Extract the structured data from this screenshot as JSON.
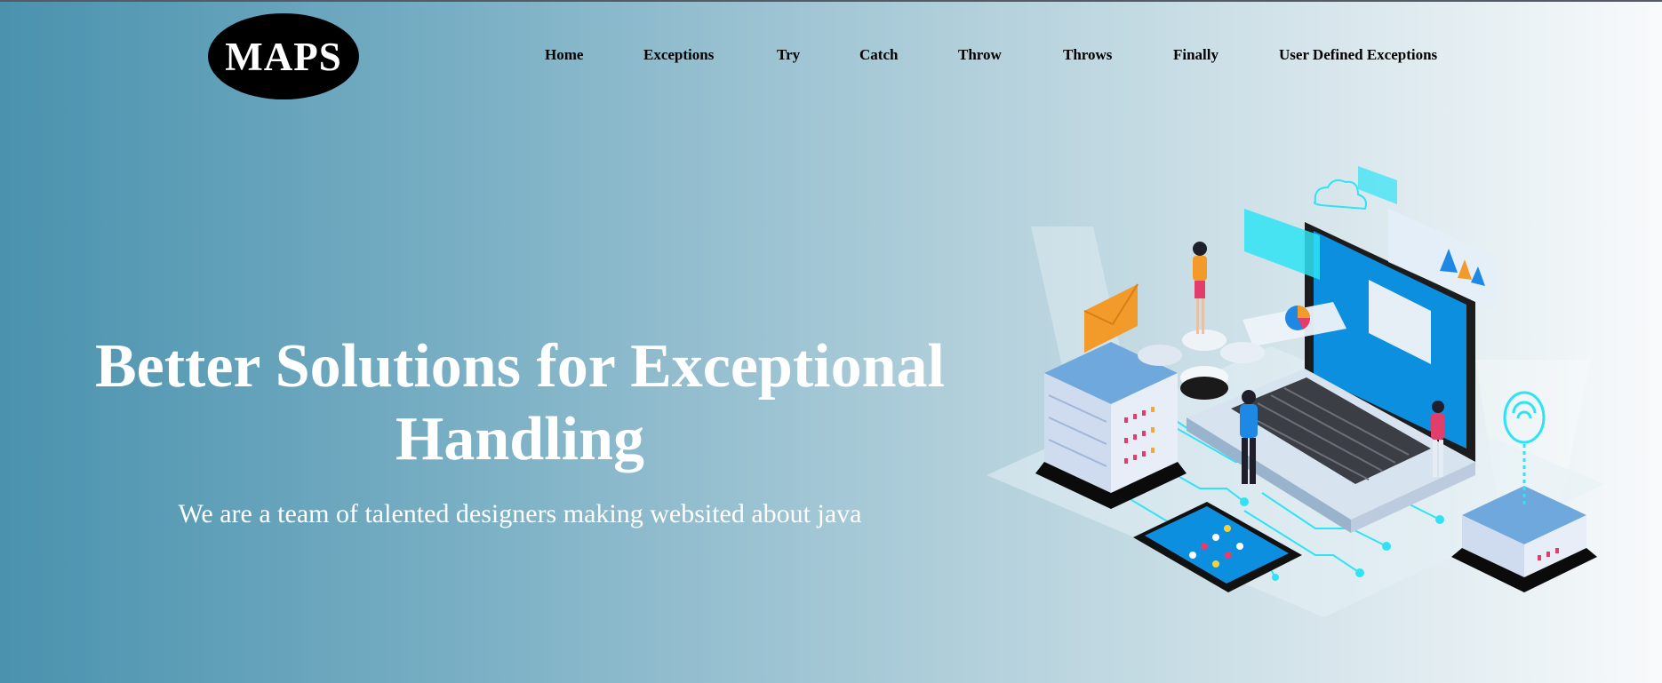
{
  "logo": {
    "text": "MAPS"
  },
  "nav": {
    "items": [
      {
        "label": "Home"
      },
      {
        "label": "Exceptions"
      },
      {
        "label": "Try"
      },
      {
        "label": "Catch"
      },
      {
        "label": "Throw"
      },
      {
        "label": "Throws"
      },
      {
        "label": "Finally"
      },
      {
        "label": "User Defined Exceptions"
      }
    ]
  },
  "hero": {
    "title_line1": "Better Solutions for Exceptional",
    "title_line2": "Handling",
    "subtitle": "We are a team of talented designers making websited about java"
  },
  "colors": {
    "gradient_start": "#4a92ae",
    "gradient_end": "#f8fafb",
    "text_light": "#ffffff",
    "logo_bg": "#000000",
    "accent_cyan": "#2fe3f5",
    "screen_blue": "#0d8fe0"
  },
  "illustration": {
    "icons": [
      "server-rack-icon",
      "laptop-icon",
      "smartphone-icon",
      "cloud-icon",
      "envelope-icon",
      "wifi-icon",
      "bar-chart-icon",
      "pie-chart-icon",
      "database-icon"
    ]
  }
}
